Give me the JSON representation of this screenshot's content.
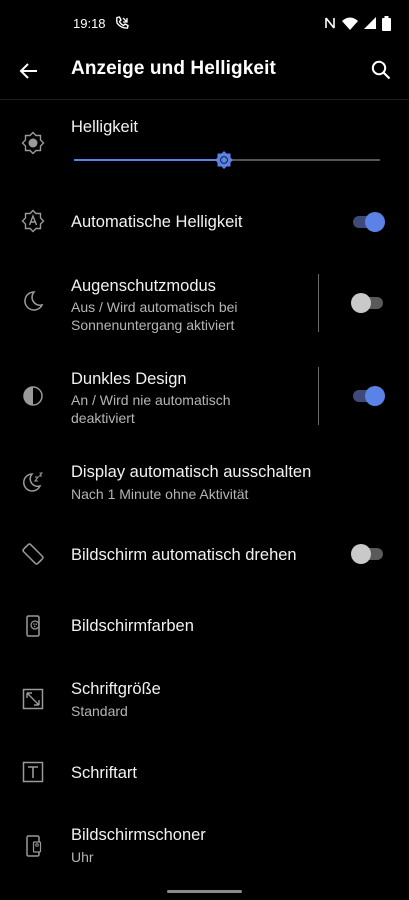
{
  "status_bar": {
    "time": "19:18"
  },
  "header": {
    "title": "Anzeige und Helligkeit"
  },
  "brightness": {
    "label": "Helligkeit",
    "level": 0.49
  },
  "settings": [
    {
      "title": "Automatische Helligkeit",
      "toggle": "on"
    },
    {
      "title": "Augenschutzmodus",
      "subtitle_line1": "Aus / Wird automatisch bei",
      "subtitle_line2": "Sonnenuntergang aktiviert",
      "toggle": "off"
    },
    {
      "title": "Dunkles Design",
      "subtitle_line1": "An / Wird nie automatisch",
      "subtitle_line2": "deaktiviert",
      "toggle": "on"
    },
    {
      "title": "Display automatisch ausschalten",
      "subtitle": "Nach 1 Minute ohne Aktivität"
    },
    {
      "title": "Bildschirm automatisch drehen",
      "toggle": "off"
    },
    {
      "title": "Bildschirmfarben"
    },
    {
      "title": "Schriftgröße",
      "subtitle": "Standard"
    },
    {
      "title": "Schriftart"
    },
    {
      "title": "Bildschirmschoner",
      "subtitle": "Uhr"
    }
  ],
  "colors": {
    "accent": "#5b82e6",
    "background": "#000000",
    "secondary_text": "#b5b5b5"
  },
  "icons": {
    "back": "arrow-left-icon",
    "search": "search-icon",
    "brightness": "brightness-icon",
    "auto_brightness": "auto-brightness-icon",
    "eye_comfort": "moon-icon",
    "dark_mode": "half-circle-icon",
    "sleep": "sleep-moon-icon",
    "rotate": "screen-rotate-icon",
    "screen_color": "screen-color-icon",
    "font_size": "font-size-icon",
    "font": "font-icon",
    "screensaver": "screensaver-icon"
  }
}
